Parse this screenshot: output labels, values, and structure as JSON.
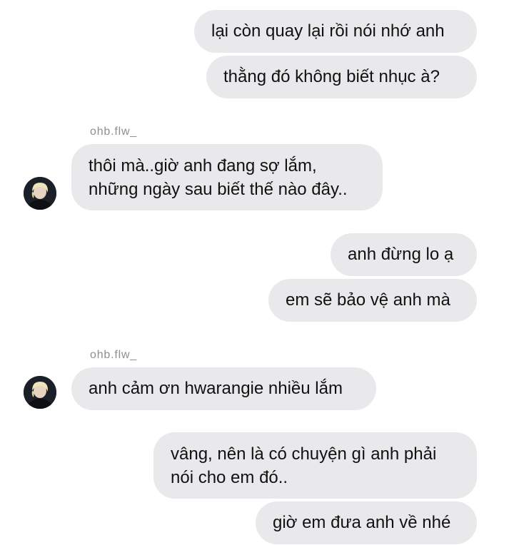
{
  "conversation": {
    "messages": [
      {
        "from": "me",
        "text": "lại còn quay lại rồi nói nhớ anh"
      },
      {
        "from": "me",
        "text": "thằng đó không biết nhục à?"
      },
      {
        "from": "them",
        "sender": "ohb.flw_",
        "lines": [
          "thôi mà..giờ anh đang sợ lắm,",
          "những ngày sau biết thế nào đây.."
        ]
      },
      {
        "from": "me",
        "text": "anh đừng lo ạ"
      },
      {
        "from": "me",
        "text": "em sẽ bảo vệ anh mà"
      },
      {
        "from": "them",
        "sender": "ohb.flw_",
        "text": "anh cảm ơn hwarangie nhiều lắm"
      },
      {
        "from": "me",
        "lines": [
          "vâng, nên là có chuyện gì anh phải",
          "nói cho em đó.."
        ]
      },
      {
        "from": "me",
        "text": "giờ em đưa anh về nhé"
      }
    ]
  },
  "style": {
    "bubble_color": "#e9e9ec",
    "sender_color": "#8e8e93",
    "text_color": "#111111",
    "avatar_icon": "person-avatar-icon"
  }
}
